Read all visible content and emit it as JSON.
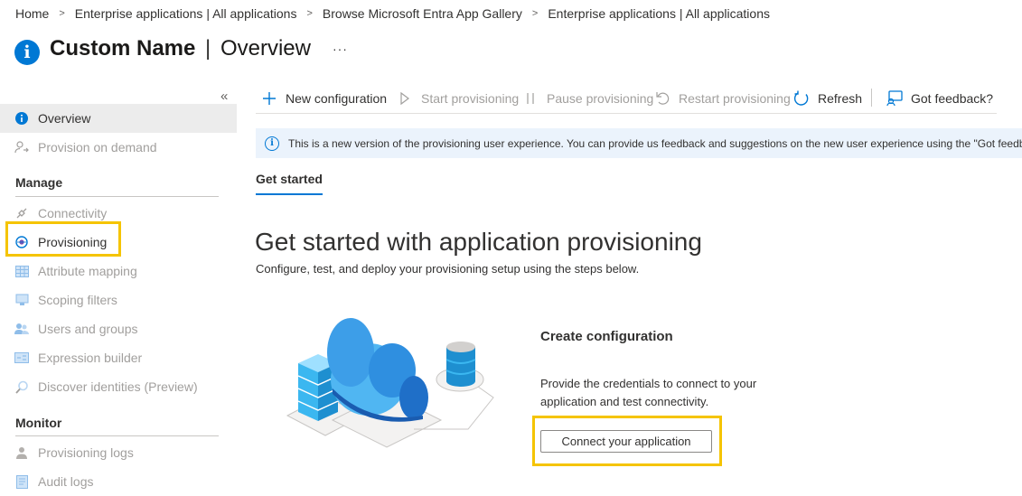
{
  "breadcrumb": [
    "Home",
    "Enterprise applications | All applications",
    "Browse Microsoft Entra App Gallery",
    "Enterprise applications | All applications"
  ],
  "title": {
    "name": "Custom Name",
    "separator": "|",
    "section": "Overview",
    "more": "···"
  },
  "sidebar": {
    "collapse": "«",
    "top_items": [
      {
        "label": "Overview",
        "icon": "info-icon",
        "active": true
      },
      {
        "label": "Provision on demand",
        "icon": "person-sync-icon",
        "active": false
      }
    ],
    "manage": {
      "label": "Manage",
      "items": [
        {
          "label": "Connectivity",
          "icon": "plug-icon"
        },
        {
          "label": "Provisioning",
          "icon": "provisioning-globe-icon"
        },
        {
          "label": "Attribute mapping",
          "icon": "table-icon"
        },
        {
          "label": "Scoping filters",
          "icon": "filter-icon"
        },
        {
          "label": "Users and groups",
          "icon": "users-icon"
        },
        {
          "label": "Expression builder",
          "icon": "expression-icon"
        },
        {
          "label": "Discover identities (Preview)",
          "icon": "search-icon"
        }
      ]
    },
    "monitor": {
      "label": "Monitor",
      "items": [
        {
          "label": "Provisioning logs",
          "icon": "person-log-icon"
        },
        {
          "label": "Audit logs",
          "icon": "audit-log-icon"
        }
      ]
    }
  },
  "toolbar": {
    "new_configuration": "New configuration",
    "start_provisioning": "Start provisioning",
    "pause_provisioning": "Pause provisioning",
    "restart_provisioning": "Restart provisioning",
    "refresh": "Refresh",
    "feedback": "Got feedback?"
  },
  "info_banner": "This is a new version of the provisioning user experience. You can provide us feedback and suggestions on the new user experience using the \"Got feedba",
  "tab": "Get started",
  "main": {
    "heading": "Get started with application provisioning",
    "subheading": "Configure, test, and deploy your provisioning setup using the steps below.",
    "step": {
      "title": "Create configuration",
      "description": "Provide the credentials to connect to your application and test connectivity.",
      "button": "Connect your application"
    }
  },
  "colors": {
    "accent": "#0078d4",
    "highlight": "#f5c400",
    "disabled": "#a19f9d",
    "banner": "#ebf3fc"
  }
}
